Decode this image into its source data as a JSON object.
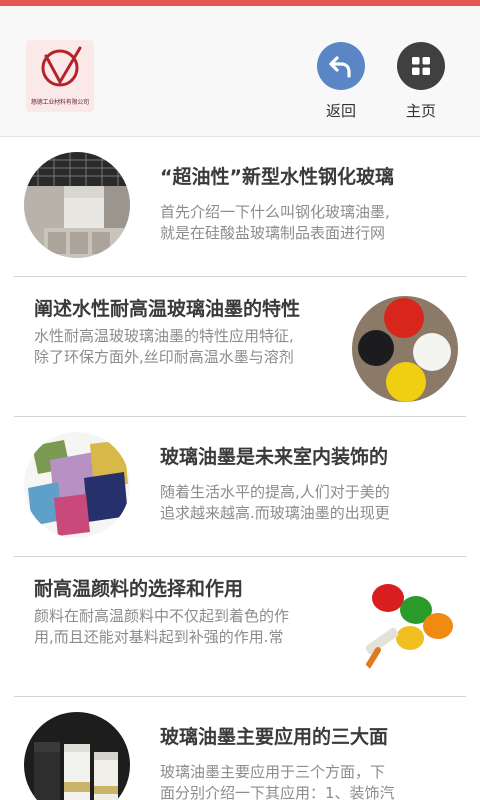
{
  "header": {
    "logo_text": "慈德工业材料有限公司",
    "back_label": "返回",
    "home_label": "主页",
    "back_icon": "undo-arrow-icon",
    "home_icon": "grid-icon"
  },
  "colors": {
    "top_strip": "#e35a52",
    "back_button": "#5b86c6",
    "home_button": "#404040"
  },
  "articles": [
    {
      "title": "“超油性”新型水性钢化玻璃",
      "desc_line1": "首先介绍一下什么叫钢化玻璃油墨,",
      "desc_line2": "就是在硅酸盐玻璃制品表面进行网"
    },
    {
      "title": "阐述水性耐高温玻璃油墨的特性",
      "desc_line1": "水性耐高温玻玻璃油墨的特性应用特征,",
      "desc_line2": "除了环保方面外,丝印耐高温水墨与溶剂"
    },
    {
      "title": "玻璃油墨是未来室内装饰的",
      "desc_line1": "随着生活水平的提高,人们对于美的",
      "desc_line2": "追求越来越高.而玻璃油墨的出现更"
    },
    {
      "title": "耐高温颜料的选择和作用",
      "desc_line1": "颜料在耐高温颜料中不仅起到着色的作",
      "desc_line2": "用,而且还能对基料起到补强的作用.常"
    },
    {
      "title": "玻璃油墨主要应用的三大面",
      "desc_line1": "玻璃油墨主要应用于三个方面，下",
      "desc_line2": "面分别介绍一下其应用：1、装饰汽"
    }
  ]
}
